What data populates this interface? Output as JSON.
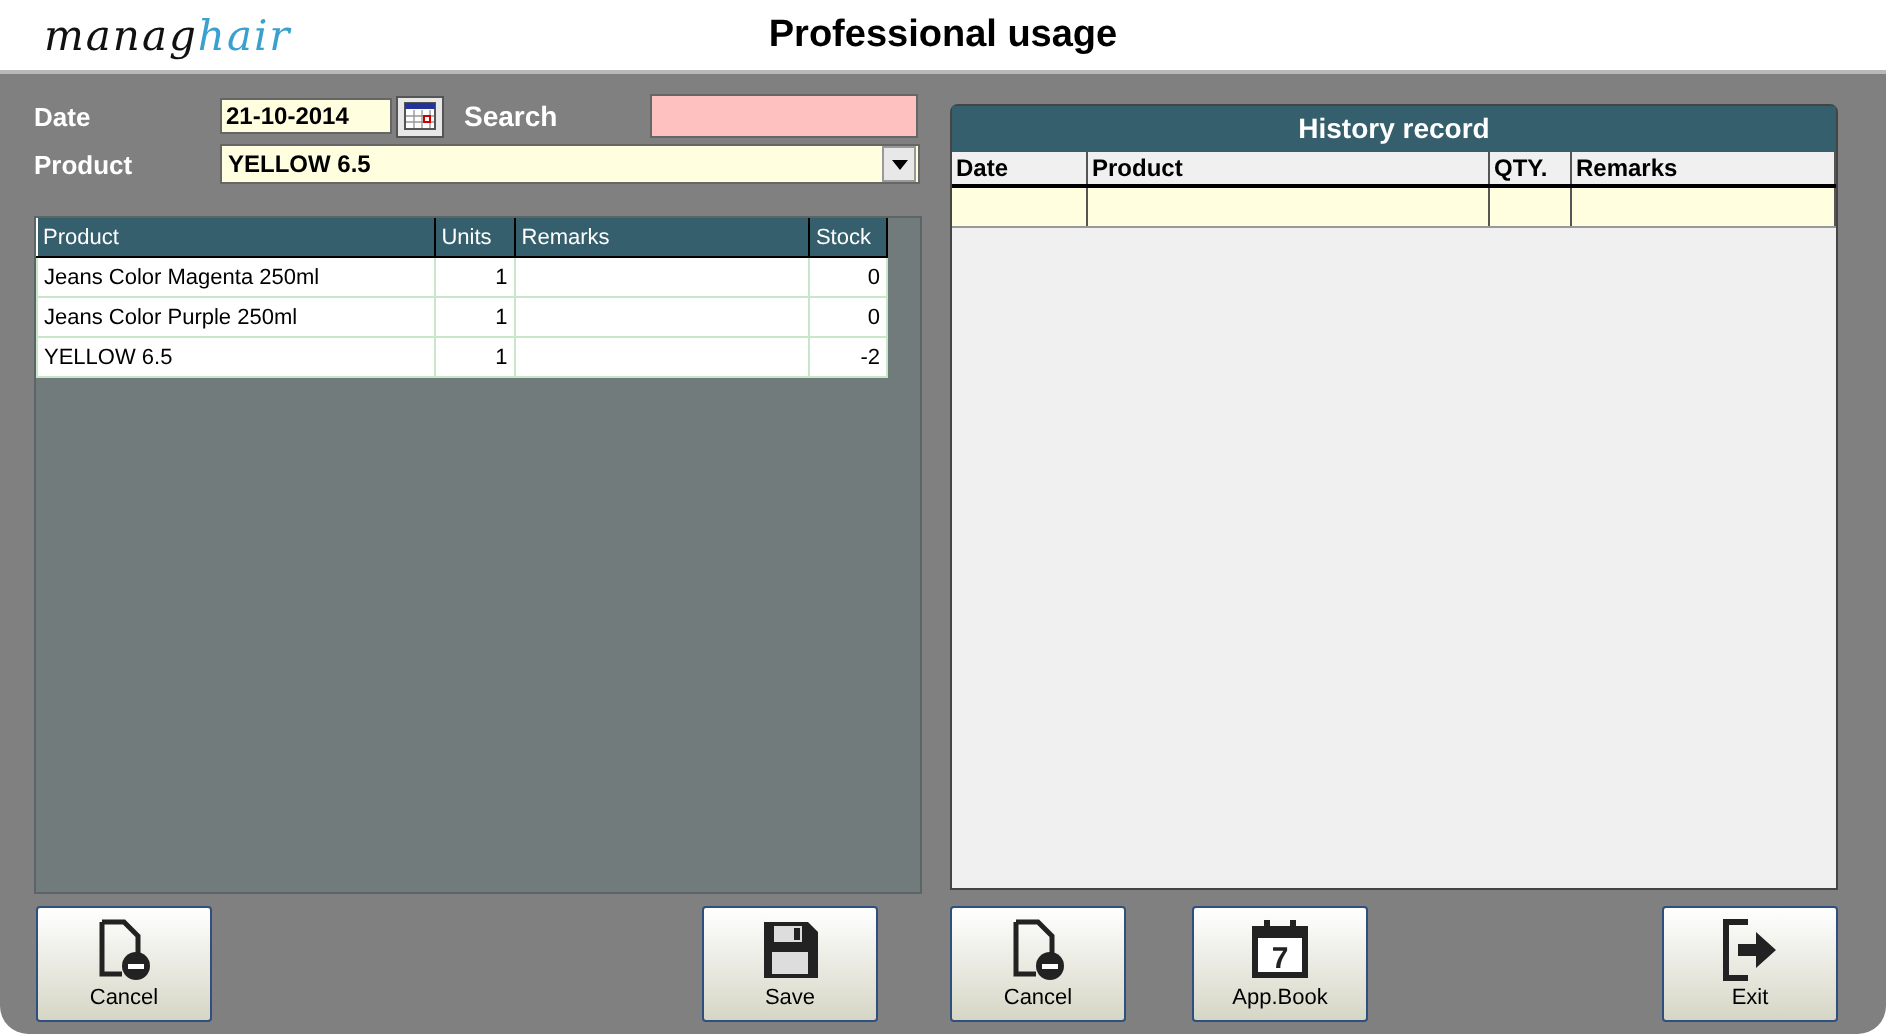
{
  "header": {
    "logo_dark": "manag",
    "logo_light": "hair",
    "title": "Professional usage"
  },
  "form": {
    "date_label": "Date",
    "date_value": "21-10-2014",
    "search_label": "Search",
    "product_label": "Product",
    "product_value": "YELLOW 6.5"
  },
  "usage_table": {
    "columns": [
      "Product",
      "Units",
      "Remarks",
      "Stock"
    ],
    "rows": [
      {
        "product": "Jeans Color Magenta 250ml",
        "units": "1",
        "remarks": "",
        "stock": "0"
      },
      {
        "product": "Jeans Color Purple 250ml",
        "units": "1",
        "remarks": "",
        "stock": "0"
      },
      {
        "product": "YELLOW 6.5",
        "units": "1",
        "remarks": "",
        "stock": "-2"
      }
    ]
  },
  "history": {
    "title": "History record",
    "columns": [
      "Date",
      "Product",
      "QTY.",
      "Remarks"
    ]
  },
  "left_buttons": [
    {
      "kind": "cancel",
      "label": "Cancel"
    },
    {
      "kind": "save",
      "label": "Save"
    }
  ],
  "right_buttons": [
    {
      "kind": "cancel",
      "label": "Cancel"
    },
    {
      "kind": "appbook",
      "label": "App.Book",
      "icon_text": "7"
    },
    {
      "kind": "exit",
      "label": "Exit"
    }
  ]
}
